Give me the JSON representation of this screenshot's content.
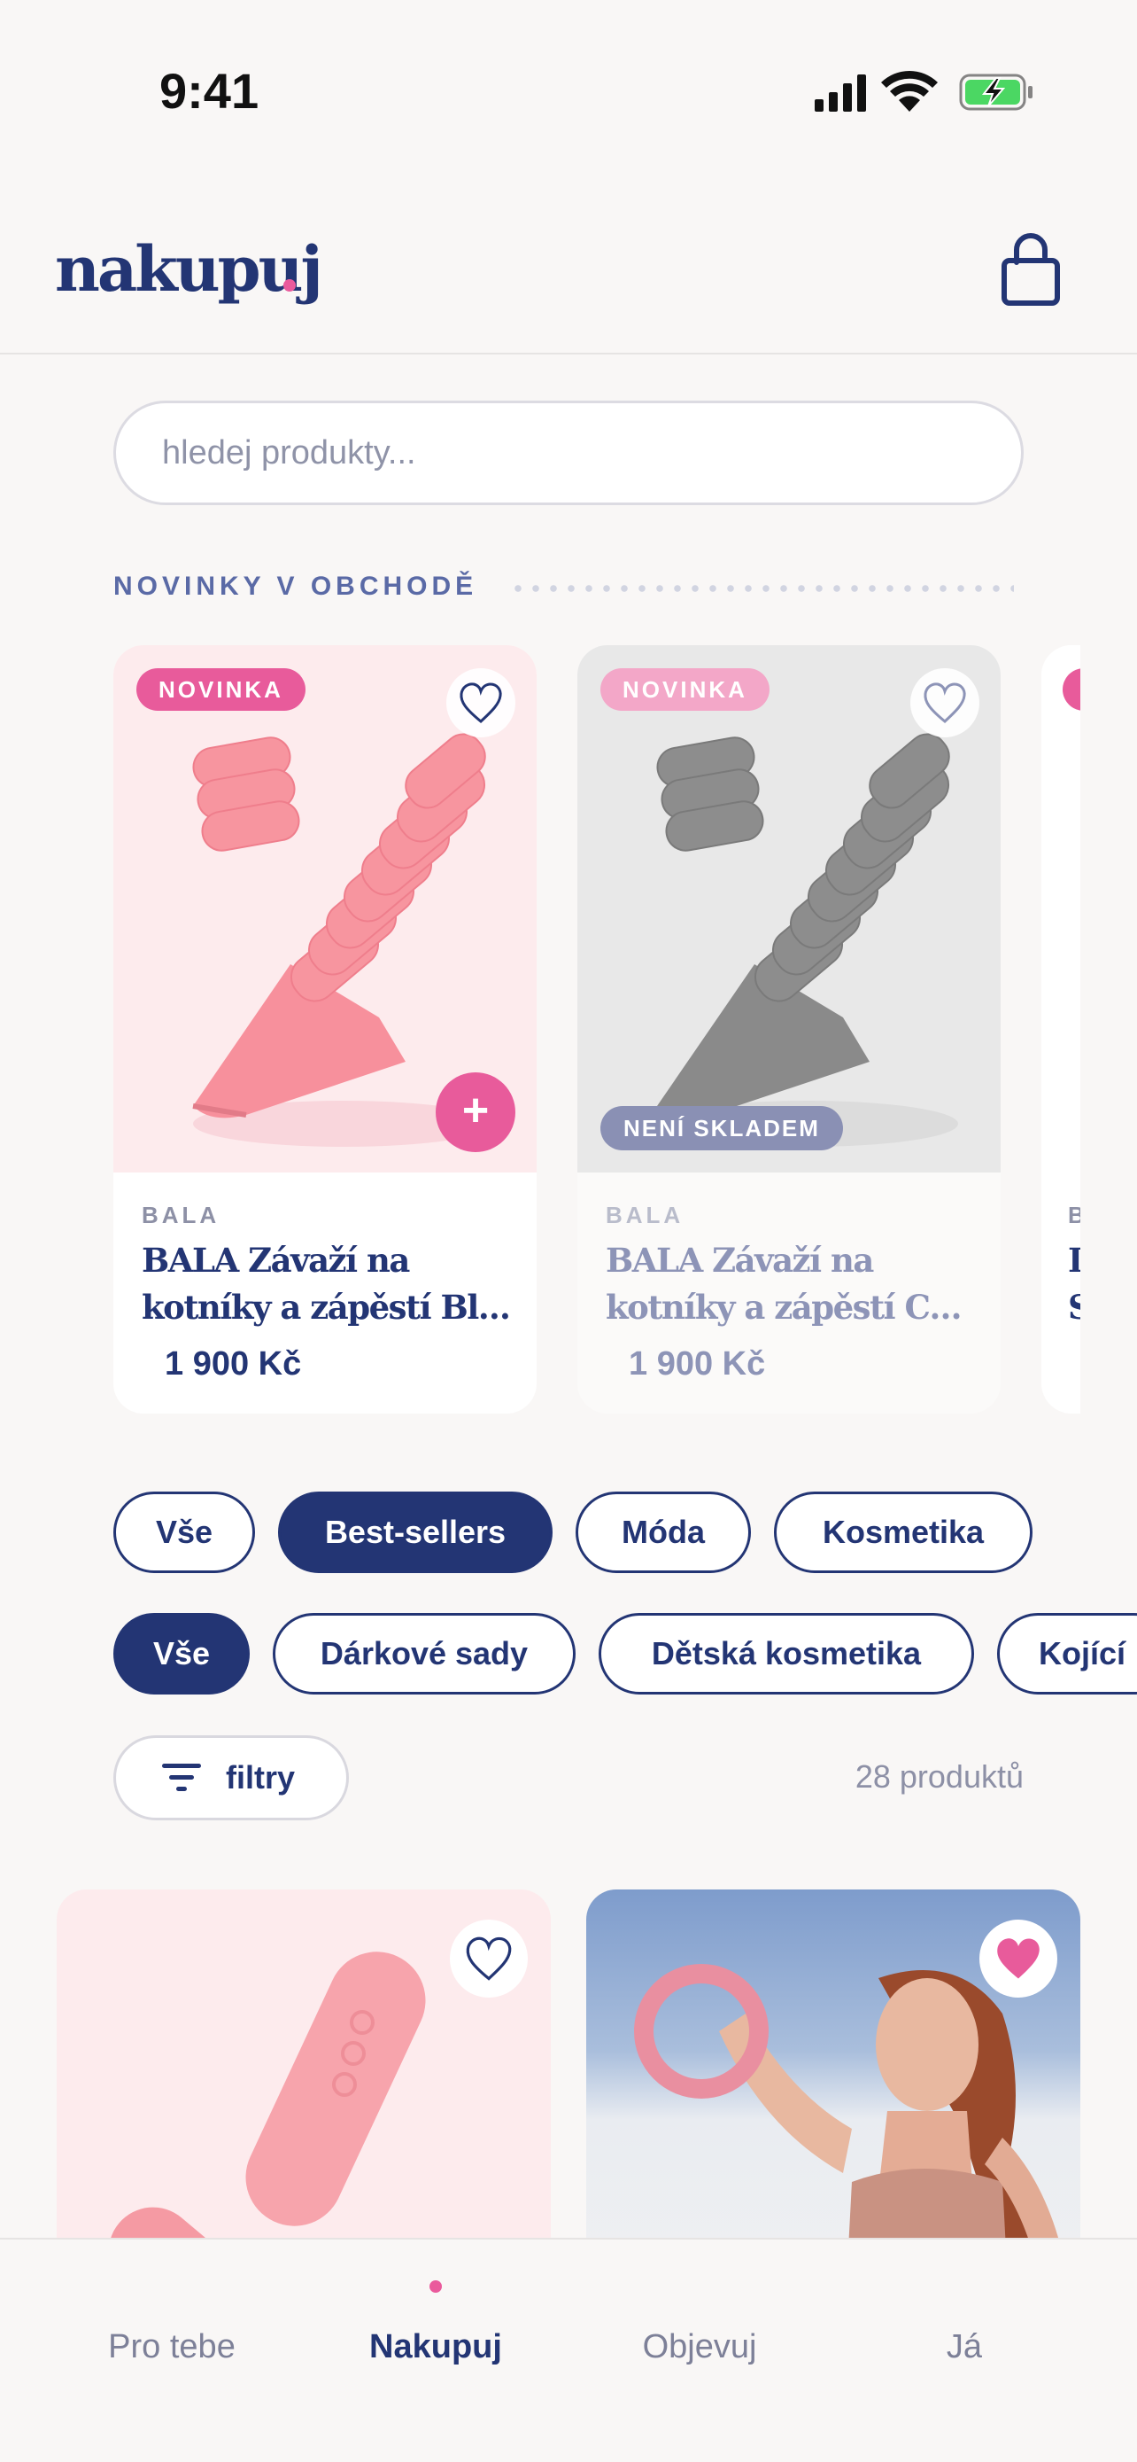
{
  "status_bar": {
    "time": "9:41"
  },
  "header": {
    "logo": "nakupuj",
    "bag_icon": "shopping-bag-icon"
  },
  "search": {
    "placeholder": "hledej produkty..."
  },
  "new_section": {
    "title": "NOVINKY V OBCHODĚ",
    "cards": [
      {
        "badge": "NOVINKA",
        "brand": "BALA",
        "name_line1": "BALA Závaží na",
        "name_line2": "kotníky a zápěstí Blus...",
        "price": "1 900 Kč",
        "add_label": "+",
        "favorite": false,
        "color": "#f7909c"
      },
      {
        "badge": "NOVINKA",
        "brand": "BALA",
        "name_line1": "BALA Závaží na",
        "name_line2": "kotníky a zápěstí Cha...",
        "price": "1 900 Kč",
        "stock_label": "NENÍ SKLADEM",
        "favorite": false,
        "color": "#8a8a8a"
      },
      {
        "brand": "B",
        "name_line1": "I",
        "name_line2": "S"
      }
    ]
  },
  "categories": [
    {
      "label": "Vše",
      "active": false
    },
    {
      "label": "Best-sellers",
      "active": true
    },
    {
      "label": "Móda",
      "active": false
    },
    {
      "label": "Kosmetika",
      "active": false
    }
  ],
  "subcategories": [
    {
      "label": "Vše",
      "active": true
    },
    {
      "label": "Dárkové sady",
      "active": false
    },
    {
      "label": "Dětská kosmetika",
      "active": false
    },
    {
      "label": "Kojící",
      "active": false
    }
  ],
  "filters": {
    "label": "filtry",
    "count_text": "28 produktů"
  },
  "grid": [
    {
      "favorite": false
    },
    {
      "favorite": true
    }
  ],
  "tabbar": {
    "items": [
      {
        "label": "Pro tebe",
        "active": false
      },
      {
        "label": "Nakupuj",
        "active": true
      },
      {
        "label": "Objevuj",
        "active": false
      },
      {
        "label": "Já",
        "active": false
      }
    ]
  },
  "colors": {
    "brand_navy": "#233574",
    "accent_pink": "#e85b9b",
    "background": "#f9f7f6"
  }
}
